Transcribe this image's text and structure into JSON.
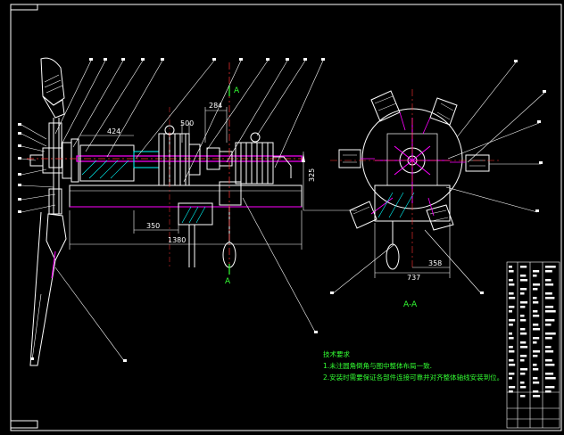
{
  "colors": {
    "background": "#000000",
    "outline": "#ffffff",
    "shaft": "#ff00ff",
    "center_line": "#ff3333",
    "hatch": "#00ffff",
    "leader": "#ffffff",
    "note_text": "#33ff33",
    "title_block": "#ffffff"
  },
  "dimensions": {
    "d500": "500",
    "d284": "284",
    "d424": "424",
    "d325": "325",
    "d350": "350",
    "d1380": "1380",
    "d737": "737",
    "d358": "358"
  },
  "section_label": "A-A",
  "section_marker_top": "A",
  "section_marker_bottom": "A",
  "notes": {
    "heading": "技术要求",
    "line1": "1.未注圆角倒角与图中整体布局一致.",
    "line2": "2.安装时需要保证各部件连接可靠并对齐整体轴线安装到位。"
  }
}
